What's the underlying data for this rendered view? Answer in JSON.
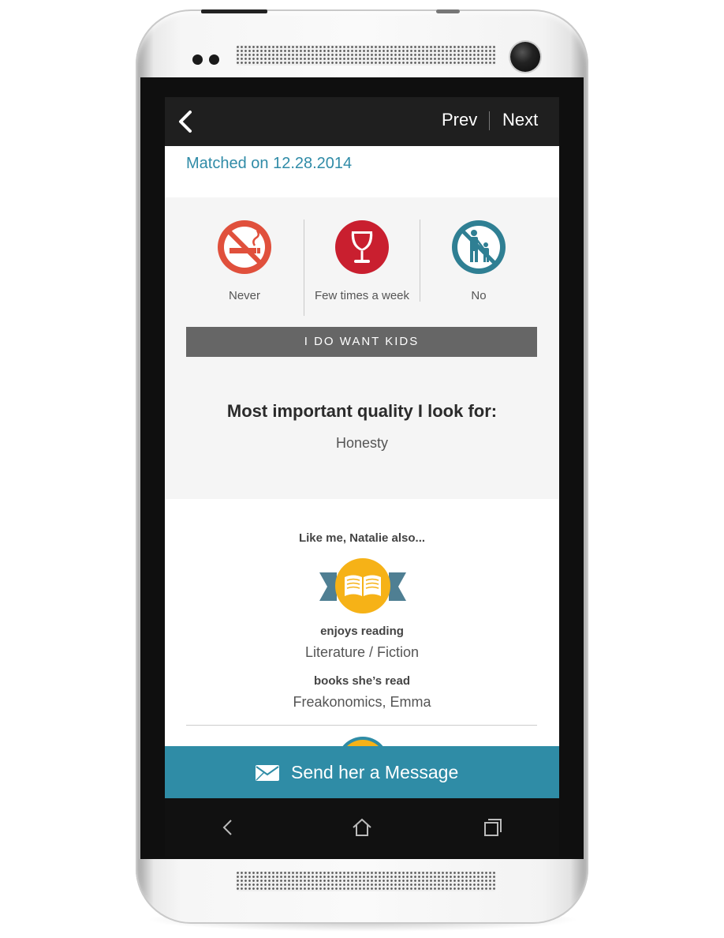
{
  "header": {
    "prev_label": "Prev",
    "next_label": "Next"
  },
  "match": {
    "matched_on": "Matched on 12.28.2014"
  },
  "lifestyle": [
    {
      "icon": "no-smoking-icon",
      "label": "Never",
      "color": "#e0503c"
    },
    {
      "icon": "wine-glass-icon",
      "label": "Few times a week",
      "color": "#c91f2f"
    },
    {
      "icon": "no-kids-icon",
      "label": "No",
      "color": "#2f7f93"
    }
  ],
  "kids_bar": "I DO WANT KIDS",
  "quality": {
    "heading": "Most important quality I look for:",
    "value": "Honesty"
  },
  "like_me": {
    "heading": "Like me, Natalie also...",
    "badge_icon": "open-book-icon",
    "interests": [
      {
        "title": "enjoys reading",
        "value": "Literature / Fiction"
      },
      {
        "title": "books she’s read",
        "value": "Freakonomics, Emma"
      }
    ]
  },
  "cta": {
    "icon": "envelope-icon",
    "label": "Send her a Message"
  },
  "android_nav": [
    "back-icon",
    "home-icon",
    "recent-apps-icon"
  ],
  "colors": {
    "accent_teal": "#2f8ca6",
    "badge_yellow": "#f6b217",
    "ribbon_slate": "#4f7f93"
  }
}
